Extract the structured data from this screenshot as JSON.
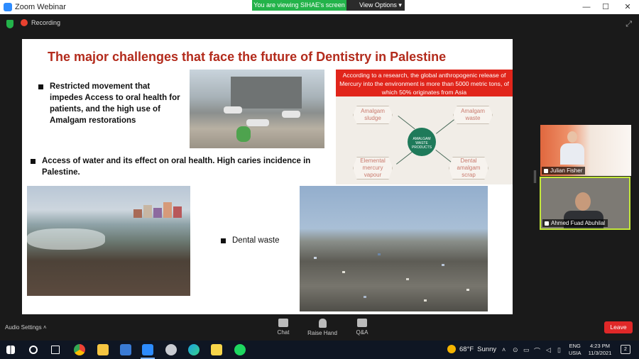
{
  "window": {
    "title": "Zoom Webinar",
    "banner_viewing": "You are viewing SIHAE's screen",
    "banner_view_options": "View Options"
  },
  "topbar": {
    "recording_label": "Recording"
  },
  "slide": {
    "title": "The major challenges that face the future of Dentistry in Palestine",
    "bullet1": "Restricted movement that impedes Access to oral health for patients, and the high use of Amalgam restorations",
    "bullet2": "Access of water and its effect on oral health. High caries incidence in Palestine.",
    "bullet3": "Dental waste",
    "research_note": "According to a research, the global anthropogenic release of Mercury into the environment is more than 5000 metric tons, of which 50% originates from Asia",
    "diagram": {
      "center": "AMALGAM WASTE PRODUCTS",
      "nodes": [
        "Amalgam sludge",
        "Amalgam waste",
        "Elemental mercury vapour",
        "Dental amalgam scrap"
      ]
    }
  },
  "participants": [
    {
      "name": "Julian Fisher"
    },
    {
      "name": "Ahmed Fuad Abuhilal"
    }
  ],
  "bottombar": {
    "audio_settings": "Audio Settings",
    "chat": "Chat",
    "raise_hand": "Raise Hand",
    "qa": "Q&A",
    "leave": "Leave"
  },
  "taskbar": {
    "weather_temp": "68°F",
    "weather_condition": "Sunny",
    "language_line1": "ENG",
    "language_line2": "USIA",
    "time": "4:23 PM",
    "date": "11/3/2021",
    "notifications": "2"
  },
  "colors": {
    "slide_title": "#b32b1c",
    "research_box": "#e1251b",
    "recording": "#e8412f",
    "banner": "#23b34a",
    "leave": "#e02828",
    "active_speaker": "#c3e83a"
  }
}
